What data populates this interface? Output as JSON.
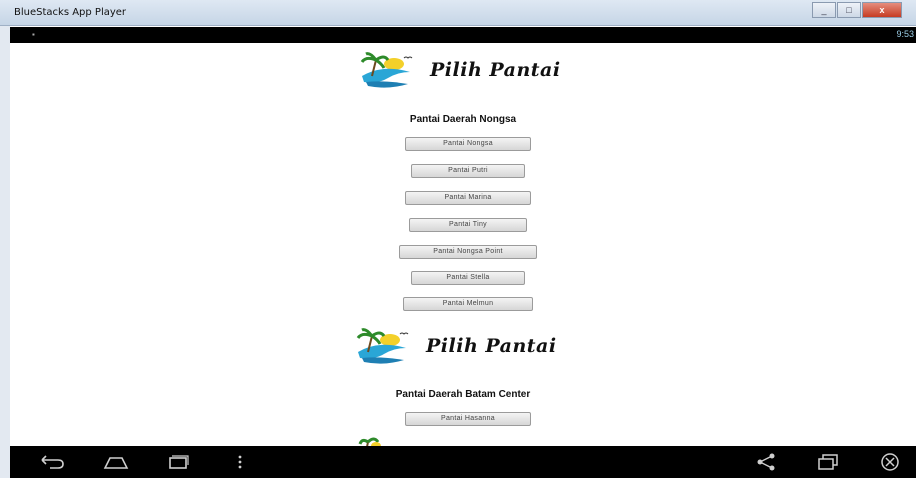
{
  "window": {
    "title": "BlueStacks App Player",
    "min_label": "_",
    "max_label": "□",
    "close_label": "x"
  },
  "statusbar": {
    "clock": "9:53"
  },
  "app": {
    "name": "Pilih Pantai"
  },
  "sections": [
    {
      "title": "Pantai Daerah Nongsa",
      "buttons": [
        "Pantai Nongsa",
        "Pantai Putri",
        "Pantai Marina",
        "Pantai Tiny",
        "Pantai Nongsa Point",
        "Pantai Stella",
        "Pantai Melmun"
      ]
    },
    {
      "title": "Pantai Daerah Batam Center",
      "buttons": [
        "Pantai Hasanna"
      ]
    }
  ],
  "navbar": {
    "icons": [
      "back-icon",
      "home-icon",
      "recent-apps-icon",
      "menu-icon",
      "share-icon",
      "window-icon",
      "close-icon"
    ]
  }
}
